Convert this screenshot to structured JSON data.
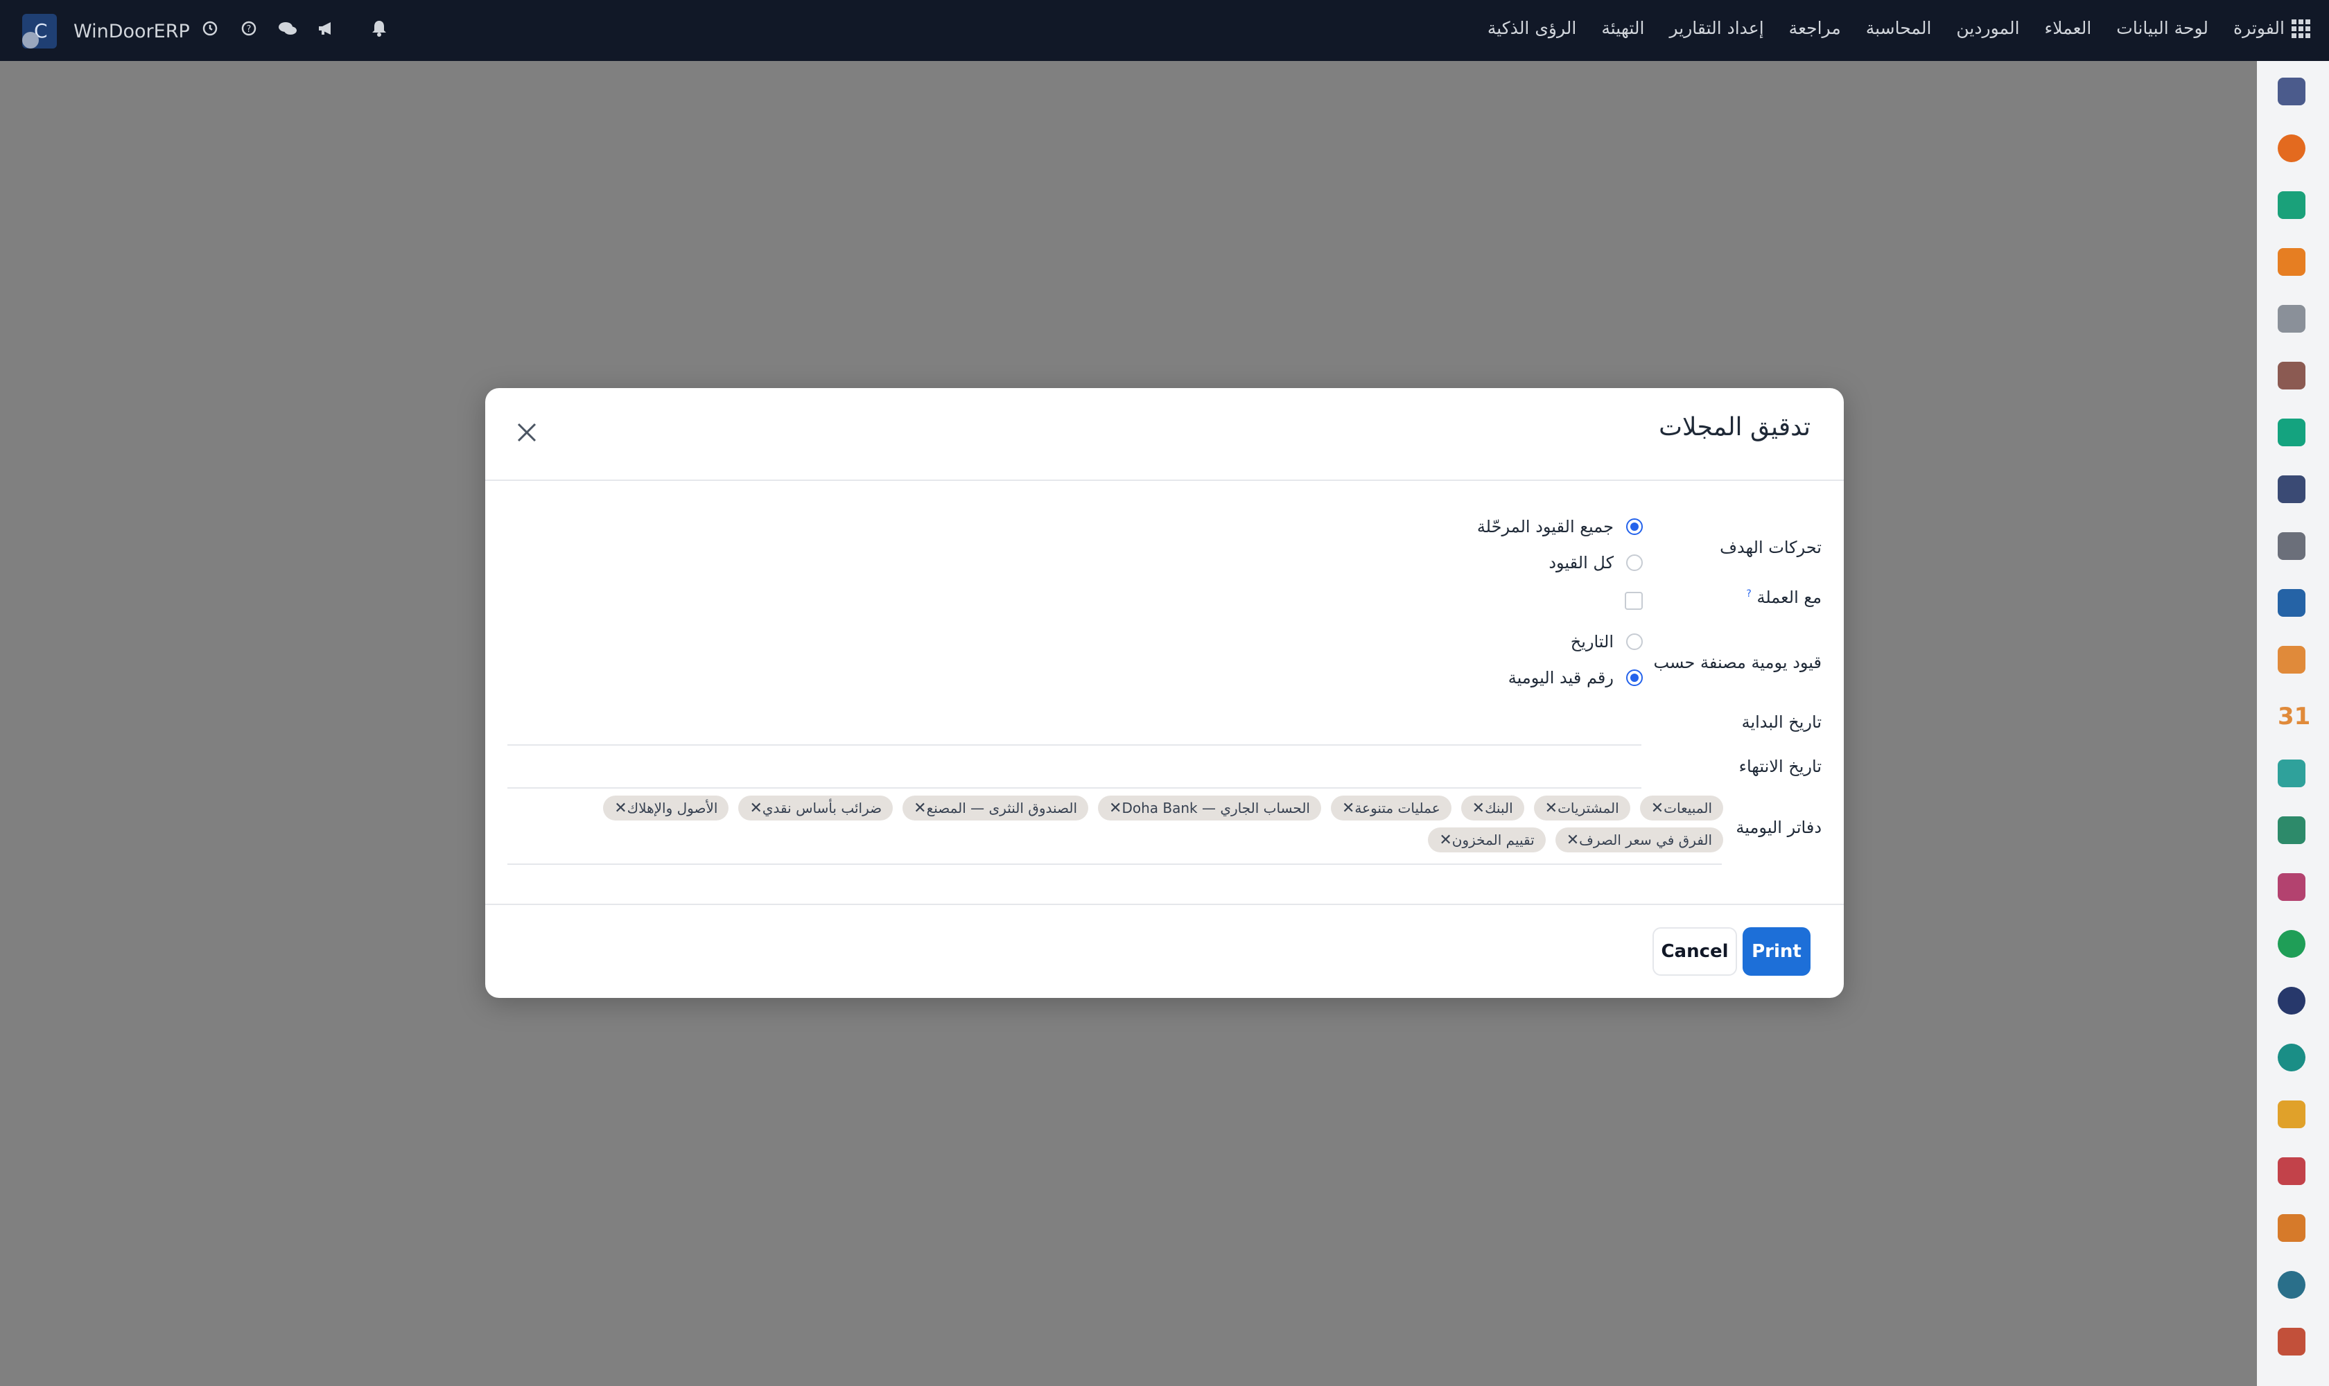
{
  "app": {
    "brand": "WinDoorERP",
    "logo_letter": "C"
  },
  "nav": {
    "items": [
      "الفوترة",
      "لوحة البيانات",
      "العملاء",
      "الموردين",
      "المحاسبة",
      "مراجعة",
      "إعداد التقارير",
      "التهيئة",
      "الرؤى الذكية"
    ]
  },
  "top_icons": [
    "clock-icon",
    "help-icon",
    "chat-icon",
    "megaphone-icon",
    "bell-icon"
  ],
  "dialog": {
    "title": "تدقيق المجلات",
    "fields": {
      "target_moves_label": "تحركات الهدف",
      "target_moves_options": [
        "جميع القيود المرحّلة",
        "كل القيود"
      ],
      "target_moves_selected": "جميع القيود المرحّلة",
      "with_currency_label": "مع العملة",
      "with_currency_help": "?",
      "with_currency_checked": false,
      "sort_by_label": "قيود يومية مصنفة حسب",
      "sort_by_options": [
        "التاريخ",
        "رقم قيد اليومية"
      ],
      "sort_by_selected": "رقم قيد اليومية",
      "start_date_label": "تاريخ البداية",
      "start_date_value": "",
      "end_date_label": "تاريخ الانتهاء",
      "end_date_value": "",
      "journals_label": "دفاتر اليومية",
      "journals": [
        "المبيعات",
        "المشتريات",
        "البنك",
        "عمليات متنوعة",
        "الحساب الجاري — Doha Bank",
        "الصندوق النثرى — المصنع",
        "ضرائب بأساس نقدي",
        "الأصول والإهلاك",
        "الفرق في سعر الصرف",
        "تقييم المخزون"
      ]
    },
    "buttons": {
      "print": "Print",
      "cancel": "Cancel"
    }
  },
  "colors": {
    "primary": "#1d6fd8",
    "navbar": "#111827",
    "backdrop": "#808080",
    "tag_bg": "#e5e1dd"
  },
  "sidebar_icons": [
    "mail-icon",
    "chat-bubble-icon",
    "check-mark-icon",
    "bar-chart-icon",
    "cube-icon",
    "contact-icon",
    "task-check-icon",
    "helpdesk-icon",
    "box-icon",
    "document-icon",
    "people-icon",
    "calendar-icon",
    "pen-icon",
    "id-card-icon",
    "dashboard-icon",
    "whatsapp-icon",
    "compass-icon",
    "planet-icon",
    "send-icon",
    "ruler-icon",
    "hexagon-icon",
    "pie-chart-icon",
    "settings-hexagon-icon"
  ]
}
